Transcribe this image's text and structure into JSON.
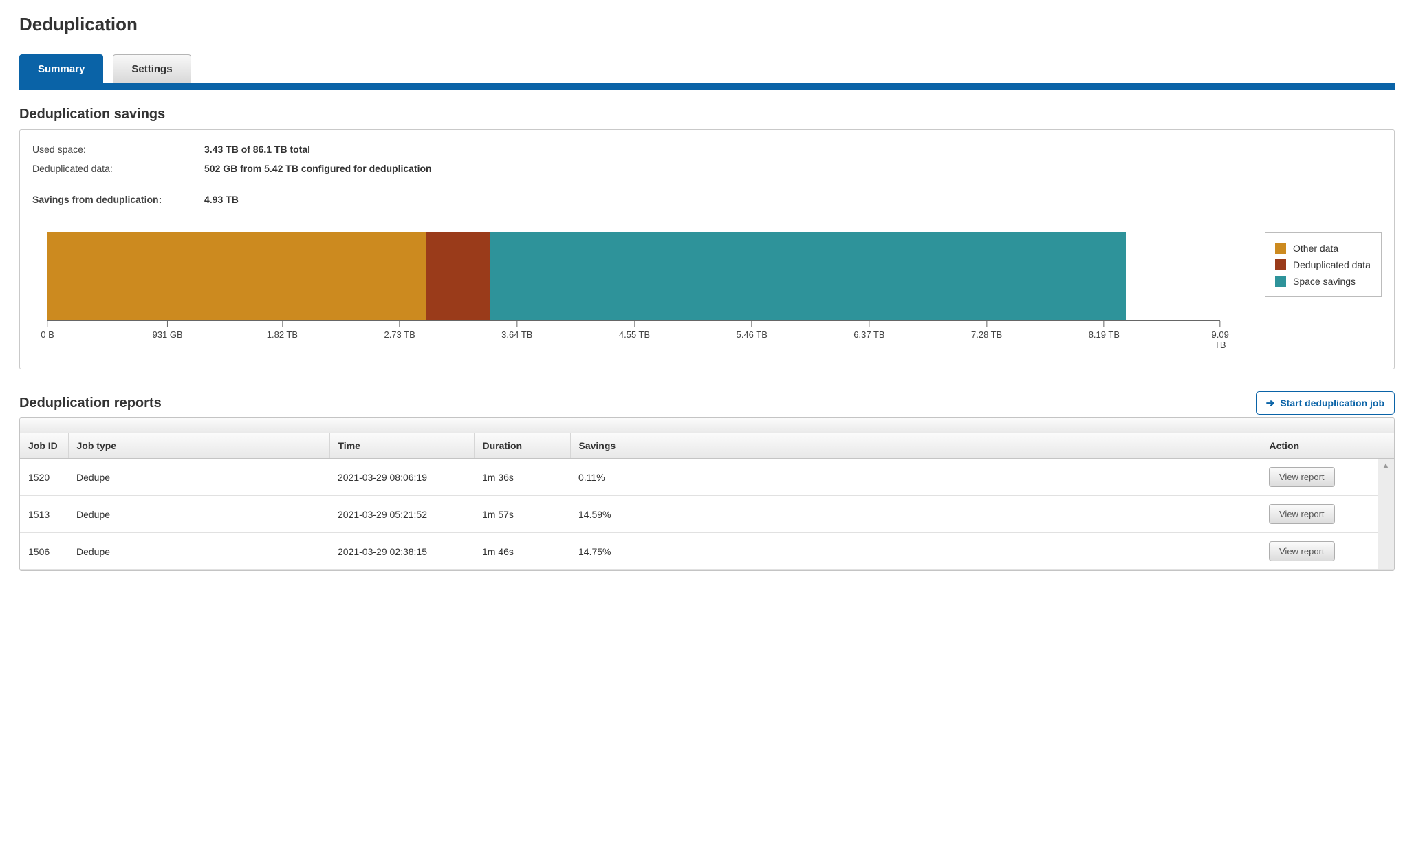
{
  "page_title": "Deduplication",
  "tabs": {
    "summary": "Summary",
    "settings": "Settings"
  },
  "savings_section": {
    "title": "Deduplication savings",
    "used_space_label": "Used space:",
    "used_space_value": "3.43 TB of 86.1 TB total",
    "dedup_data_label": "Deduplicated data:",
    "dedup_data_value": "502 GB from 5.42 TB configured for deduplication",
    "savings_label": "Savings from deduplication:",
    "savings_value": "4.93 TB"
  },
  "chart_data": {
    "type": "bar",
    "orientation": "horizontal-stacked",
    "xlabel": "",
    "ylabel": "",
    "x_ticks": [
      "0 B",
      "931 GB",
      "1.82 TB",
      "2.73 TB",
      "3.64 TB",
      "4.55 TB",
      "5.46 TB",
      "6.37 TB",
      "7.28 TB",
      "8.19 TB",
      "9.09 TB"
    ],
    "x_tick_values_tb": [
      0,
      0.931,
      1.82,
      2.73,
      3.64,
      4.55,
      5.46,
      6.37,
      7.28,
      8.19,
      9.09
    ],
    "xlim_tb": [
      0,
      9.09
    ],
    "series": [
      {
        "name": "Other data",
        "value_tb": 2.93,
        "color": "#cc8a1f"
      },
      {
        "name": "Deduplicated data",
        "value_tb": 0.5,
        "color": "#9a3b1a"
      },
      {
        "name": "Space savings",
        "value_tb": 4.93,
        "color": "#2e939a"
      }
    ],
    "total_stack_tb": 8.36
  },
  "legend": {
    "other": "Other data",
    "dedup": "Deduplicated data",
    "save": "Space savings"
  },
  "reports_section": {
    "title": "Deduplication reports",
    "start_button": "Start deduplication job",
    "columns": {
      "job_id": "Job ID",
      "job_type": "Job type",
      "time": "Time",
      "duration": "Duration",
      "savings": "Savings",
      "action": "Action"
    },
    "view_button": "View report",
    "rows": [
      {
        "job_id": "1520",
        "job_type": "Dedupe",
        "time": "2021-03-29 08:06:19",
        "duration": "1m 36s",
        "savings": "0.11%"
      },
      {
        "job_id": "1513",
        "job_type": "Dedupe",
        "time": "2021-03-29 05:21:52",
        "duration": "1m 57s",
        "savings": "14.59%"
      },
      {
        "job_id": "1506",
        "job_type": "Dedupe",
        "time": "2021-03-29 02:38:15",
        "duration": "1m 46s",
        "savings": "14.75%"
      }
    ]
  }
}
